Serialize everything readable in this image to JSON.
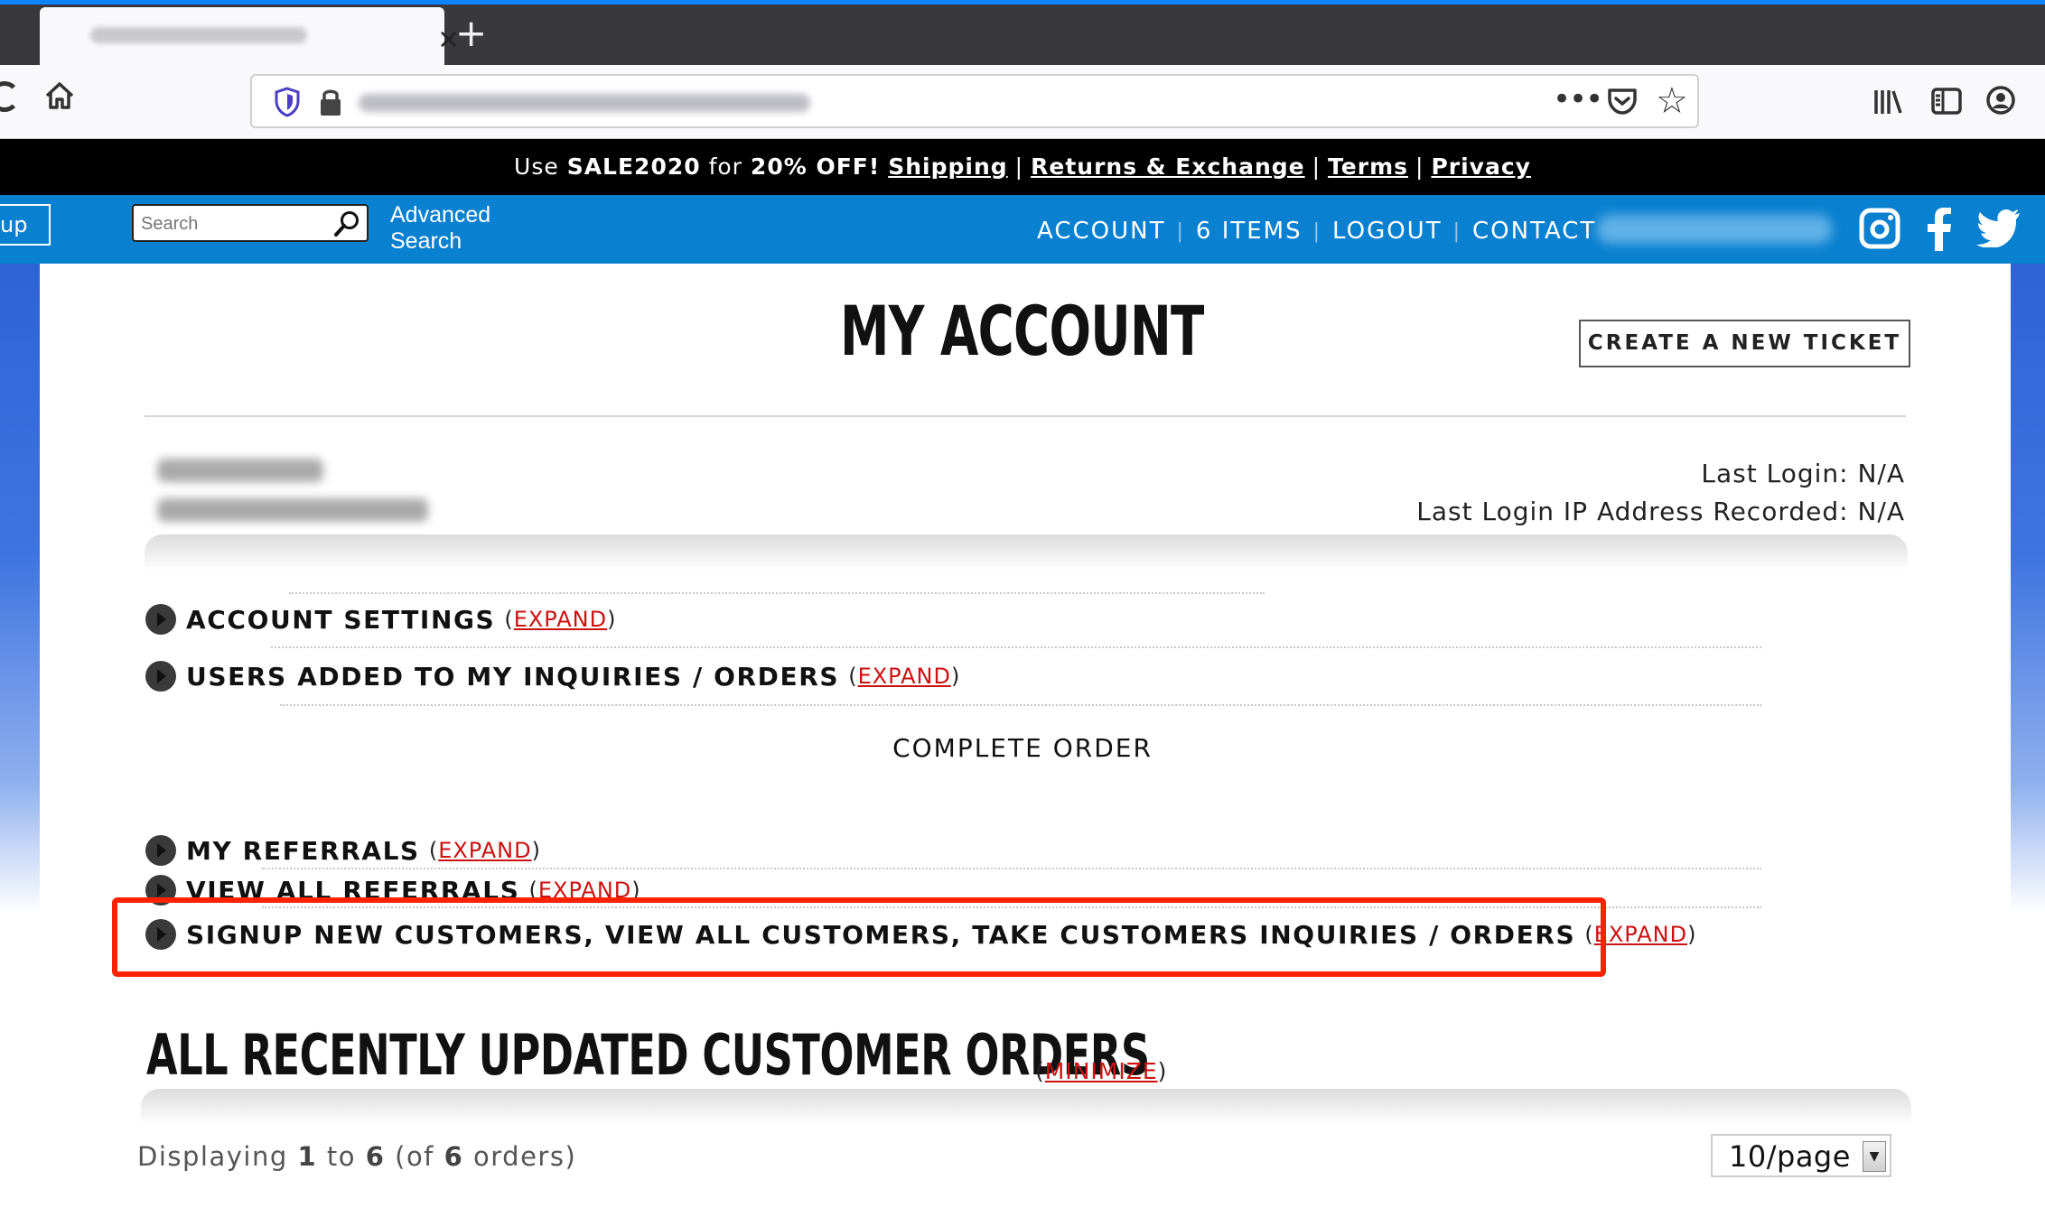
{
  "browser": {
    "tab_close": "×",
    "new_tab": "+",
    "more_actions": "•••",
    "star": "☆"
  },
  "promo": {
    "prefix": "Use ",
    "code": "SALE2020",
    "middle": " for ",
    "discount": "20% OFF!",
    "links": [
      "Shipping",
      "Returns & Exchange",
      "Terms",
      "Privacy"
    ]
  },
  "site_nav": {
    "signup_stub": "up",
    "search_placeholder": "Search",
    "advanced_search": "Advanced Search",
    "items": [
      "ACCOUNT",
      "6 ITEMS",
      "LOGOUT",
      "CONTACT"
    ]
  },
  "page": {
    "title": "MY ACCOUNT",
    "new_ticket": "CREATE A NEW TICKET",
    "last_login": "Last Login: N/A",
    "last_login_ip": "Last Login IP Address Recorded: N/A"
  },
  "sections": [
    {
      "label": "ACCOUNT SETTINGS",
      "action": "EXPAND"
    },
    {
      "label": "USERS ADDED TO MY INQUIRIES / ORDERS",
      "action": "EXPAND"
    },
    {
      "label": "MY REFERRALS",
      "action": "EXPAND"
    },
    {
      "label": "VIEW ALL REFERRALS",
      "action": "EXPAND"
    },
    {
      "label": "SIGNUP NEW CUSTOMERS, VIEW ALL CUSTOMERS, TAKE CUSTOMERS INQUIRIES / ORDERS",
      "action": "EXPAND"
    }
  ],
  "complete_order": "COMPLETE ORDER",
  "orders": {
    "title": "ALL RECENTLY UPDATED CUSTOMER ORDERS",
    "minimize": "MINIMIZE",
    "displaying_prefix": "Displaying ",
    "from": "1",
    "to_word": " to ",
    "to": "6",
    "of_prefix": " (of ",
    "total": "6",
    "of_suffix": " orders)",
    "per_page": "10/page"
  },
  "colors": {
    "nav_blue": "#0a80d0",
    "promo_bg": "#000000",
    "link_red": "#cc1111",
    "highlight": "#ff2200"
  },
  "icons": [
    "reload-icon",
    "home-icon",
    "shield-icon",
    "lock-icon",
    "pocket-icon",
    "star-icon",
    "library-icon",
    "sidebar-icon",
    "account-icon",
    "search-icon",
    "instagram-icon",
    "facebook-icon",
    "twitter-icon",
    "bullet-icon"
  ]
}
